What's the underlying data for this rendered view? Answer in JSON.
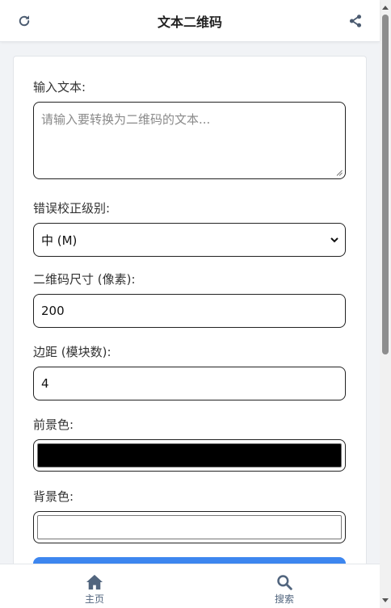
{
  "header": {
    "title": "文本二维码",
    "left_icon": "refresh-icon",
    "right_icon": "share-icon"
  },
  "form": {
    "text_label": "输入文本:",
    "text_placeholder": "请输入要转换为二维码的文本...",
    "error_correction_label": "错误校正级别:",
    "error_correction_value": "中 (M)",
    "size_label": "二维码尺寸 (像素):",
    "size_value": "200",
    "margin_label": "边距 (模块数):",
    "margin_value": "4",
    "foreground_label": "前景色:",
    "foreground_color": "#000000",
    "background_label": "背景色:",
    "background_color": "#ffffff"
  },
  "nav": {
    "home_label": "主页",
    "home_icon": "home-icon",
    "search_label": "搜索",
    "search_icon": "search-icon"
  },
  "colors": {
    "accent": "#3d86ef",
    "icon": "#4b5b70",
    "nav_icon": "#51657e"
  }
}
